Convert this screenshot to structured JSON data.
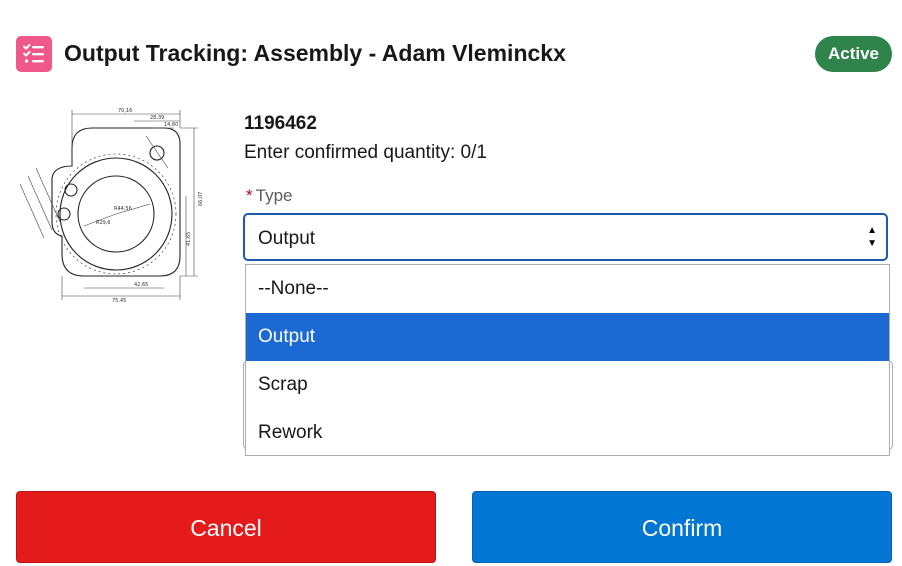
{
  "header": {
    "title": "Output Tracking: Assembly - Adam Vleminckx",
    "status": "Active",
    "icon": "task-list-icon"
  },
  "item": {
    "id": "1196462",
    "quantity_text": "Enter confirmed quantity: 0/1"
  },
  "type_field": {
    "required_marker": "*",
    "label": "Type",
    "value": "Output",
    "options": [
      "--None--",
      "Output",
      "Scrap",
      "Rework"
    ],
    "selected_index": 1
  },
  "buttons": {
    "cancel": "Cancel",
    "confirm": "Confirm"
  },
  "colors": {
    "app_icon": "#f0578b",
    "status_badge": "#2e844a",
    "focus_border": "#1b5aa6",
    "selected_option": "#1b6ad4",
    "cancel": "#e51a1a",
    "confirm": "#0176d3"
  }
}
